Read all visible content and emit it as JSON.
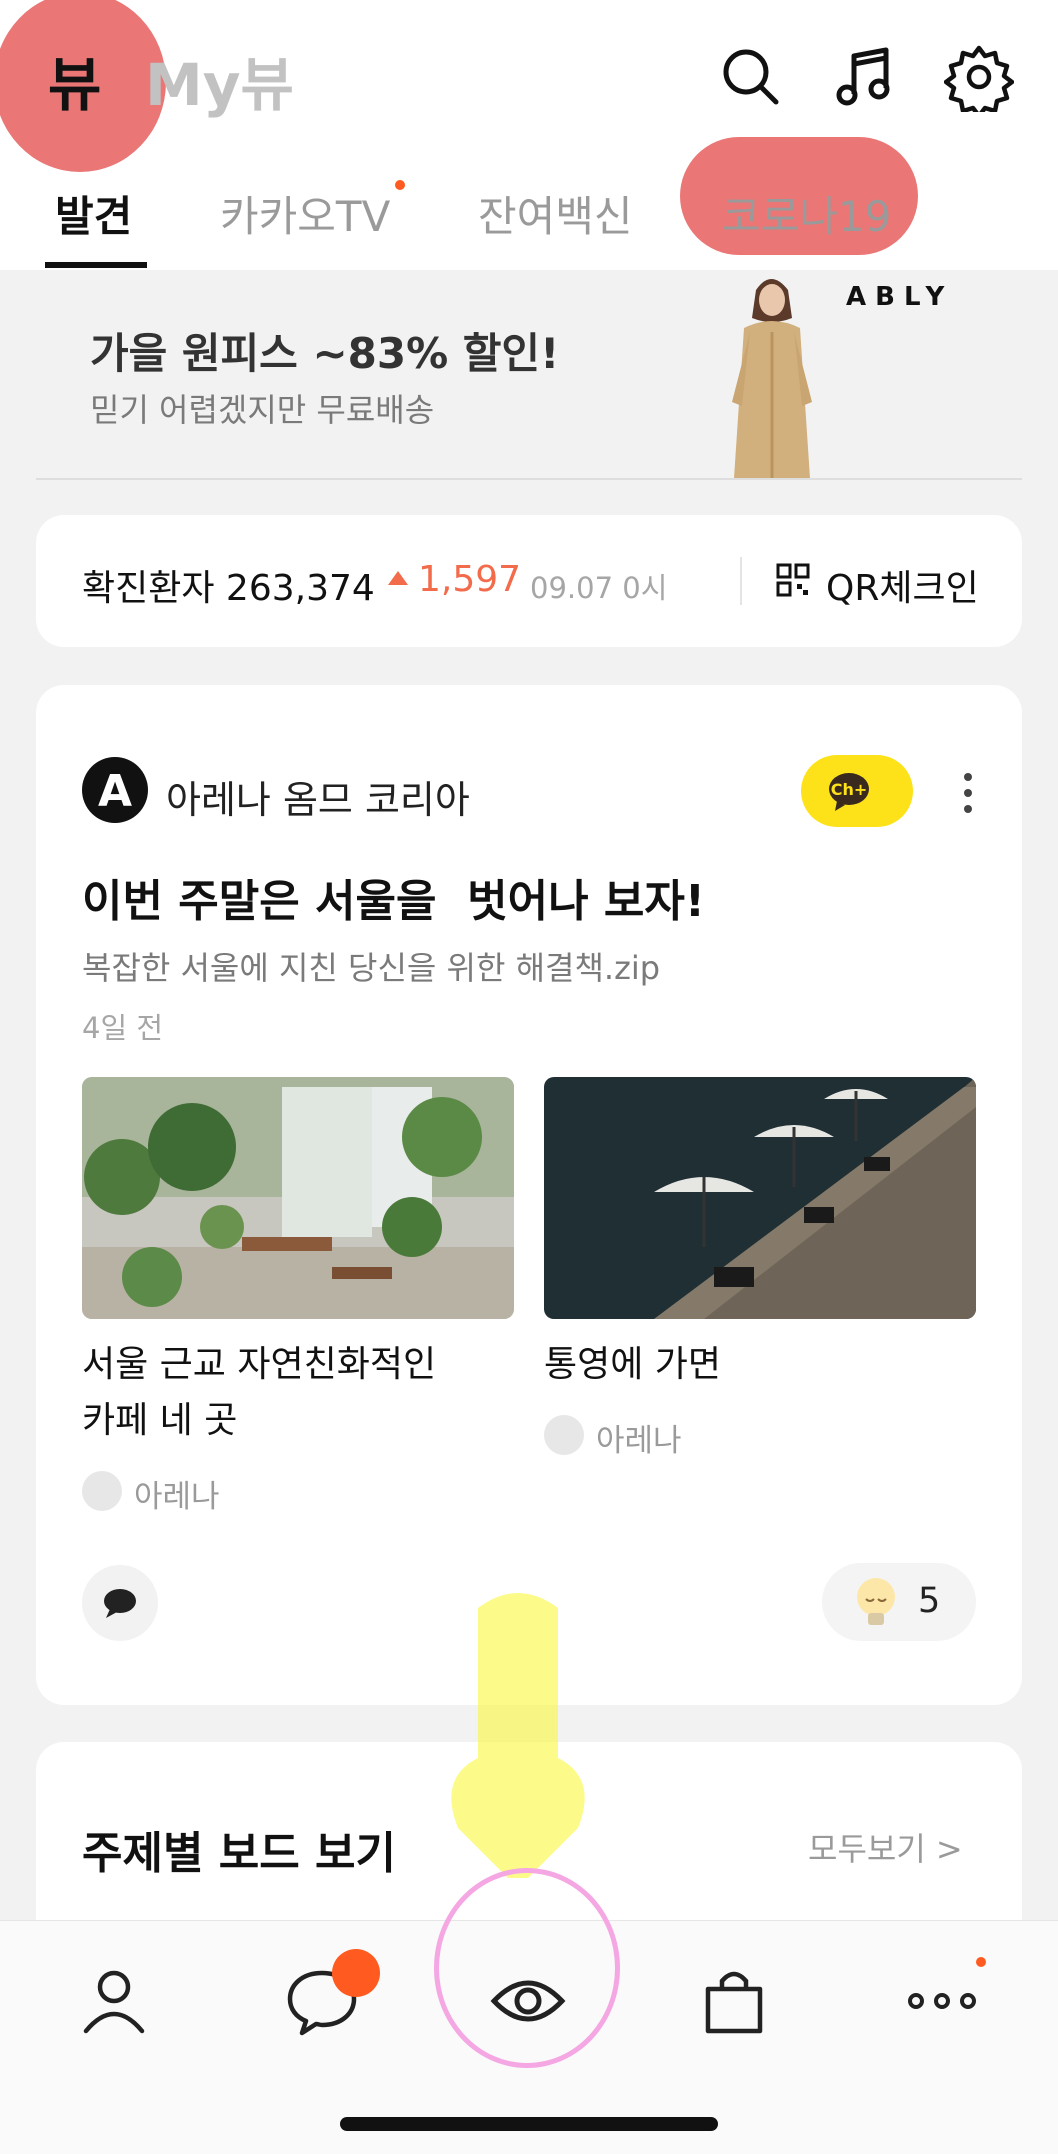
{
  "header": {
    "view_tab": "뷰",
    "myview_tab": "My뷰",
    "icons": [
      "search-icon",
      "music-icon",
      "gear-icon"
    ]
  },
  "subtabs": [
    {
      "label": "발견",
      "active": true
    },
    {
      "label": "카카오TV",
      "has_new": true
    },
    {
      "label": "잔여백신"
    },
    {
      "label": "코로나19"
    }
  ],
  "ad": {
    "headline": "가을 원피스 ~83% 할인!",
    "subtext": "믿기 어렵겠지만 무료배송",
    "brand": "ABLY"
  },
  "covid": {
    "label": "확진환자 263,374",
    "delta": "1,597",
    "timestamp": "09.07 0시",
    "qr_label": "QR체크인"
  },
  "post": {
    "channel_name": "아레나 옴므 코리아",
    "channel_logo_letter": "A",
    "add_channel_label": "Ch+",
    "title": "이번 주말은 서울을  벗어나 보자!",
    "subtitle": "복잡한 서울에 지친 당신을 위한 해결책.zip",
    "time": "4일 전",
    "articles": [
      {
        "title_line1": "서울 근교 자연친화적인",
        "title_line2": "카페 네 곳",
        "source": "아레나"
      },
      {
        "title_line1": "통영에 가면",
        "title_line2": "",
        "source": "아레나"
      }
    ],
    "reaction_count": "5"
  },
  "board": {
    "title": "주제별 보드 보기",
    "view_all": "모두보기 >"
  },
  "bottom_nav": {
    "items": [
      "profile-icon",
      "chat-icon",
      "view-icon",
      "shopping-bag-icon",
      "more-icon"
    ],
    "active": "view-icon"
  },
  "colors": {
    "accent_orange": "#ff5a1f",
    "delta_red": "#f26b4b",
    "kakao_yellow": "#fde21a"
  }
}
